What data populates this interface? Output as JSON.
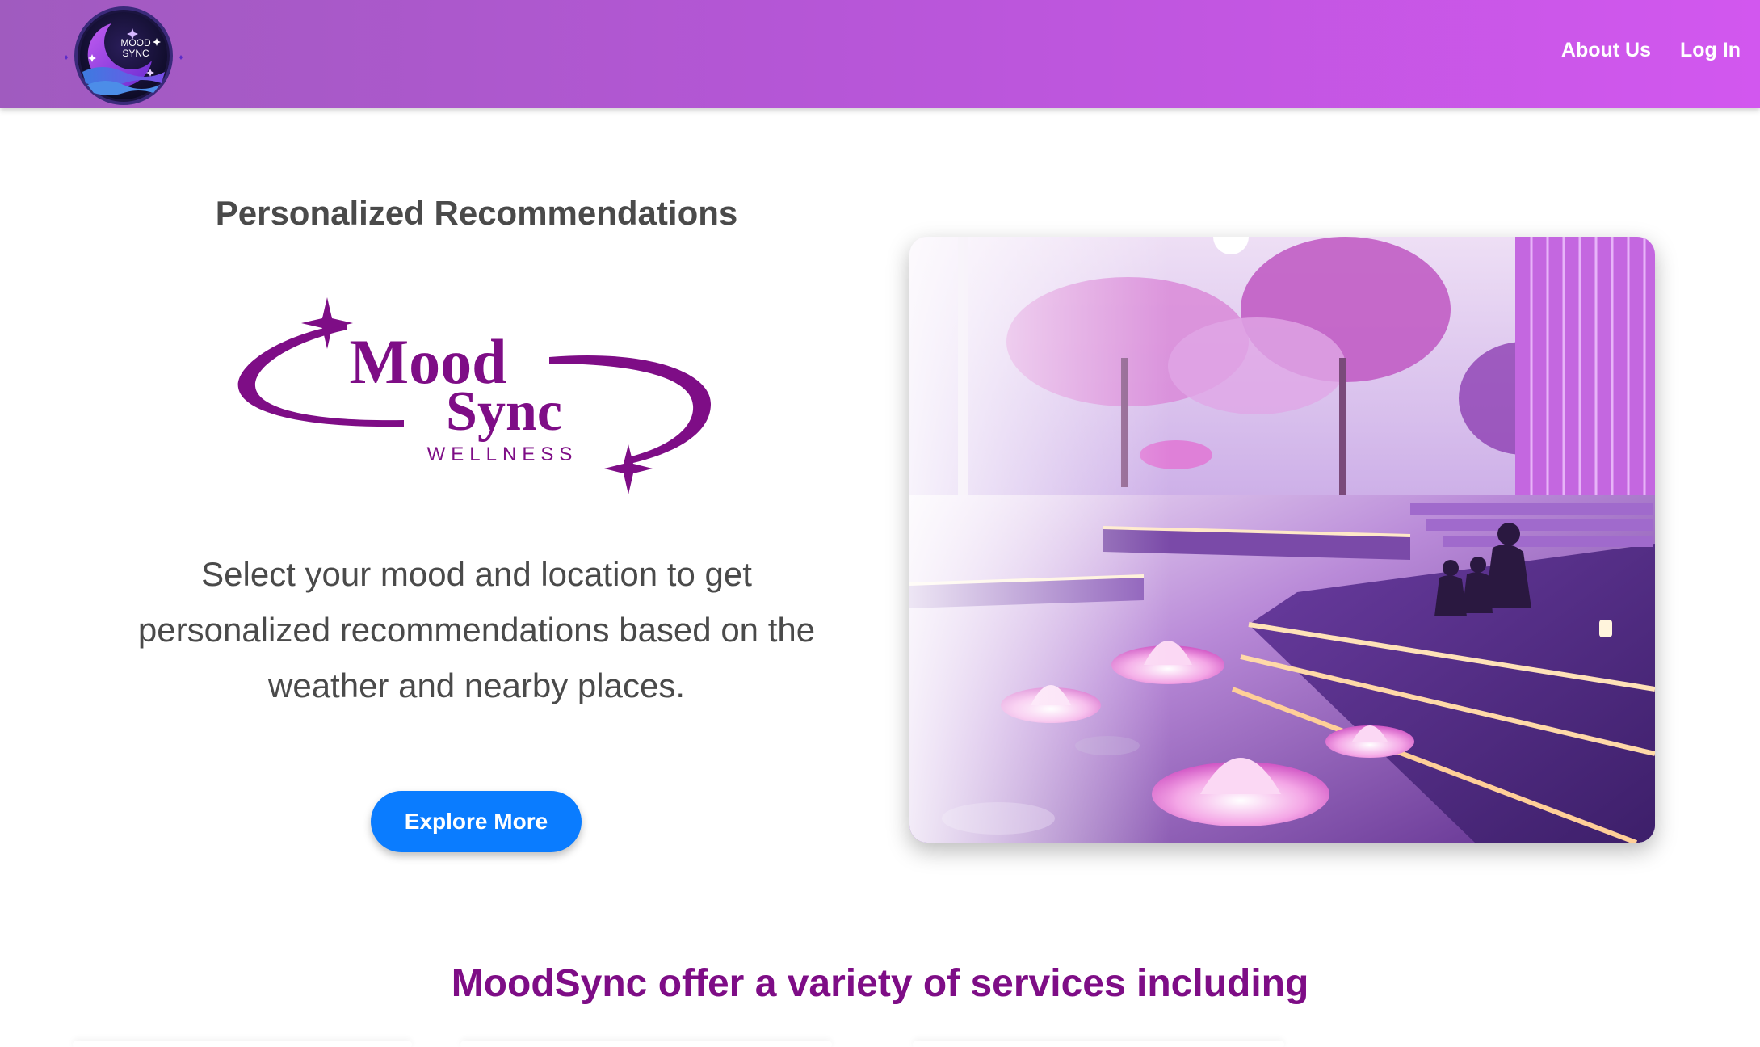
{
  "header": {
    "logo_text": [
      "MOOD",
      "SYNC"
    ],
    "nav": [
      {
        "label": "About Us"
      },
      {
        "label": "Log In"
      }
    ]
  },
  "hero": {
    "title": "Personalized Recommendations",
    "brand_logo": {
      "line1": "Mood",
      "line2": "Sync",
      "line3": "WELLNESS"
    },
    "description": "Select your mood and location to get personalized recommendations based on the weather and nearby places.",
    "button_label": "Explore More"
  },
  "services": {
    "title": "MoodSync offer a variety of services including"
  },
  "colors": {
    "header_start": "#a05bbf",
    "header_end": "#d257ef",
    "brand_purple": "#7e0d86",
    "button_blue": "#0a7cff"
  }
}
